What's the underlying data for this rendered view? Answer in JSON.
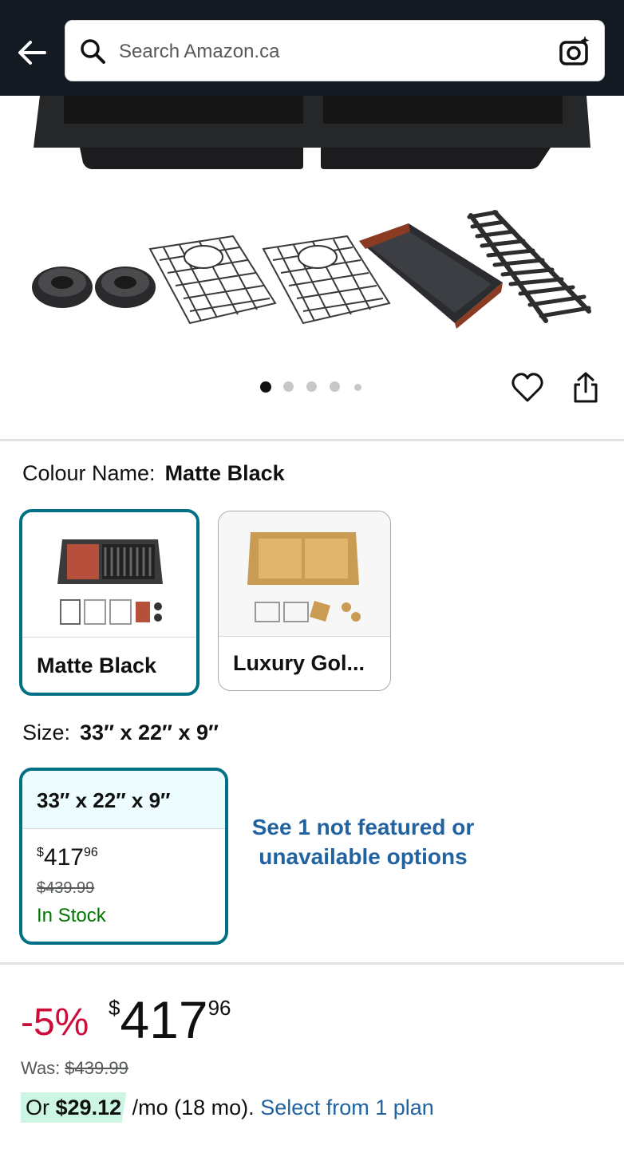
{
  "header": {
    "search_placeholder": "Search Amazon.ca",
    "icons": [
      "back-arrow-icon",
      "search-icon",
      "camera-search-icon"
    ]
  },
  "gallery": {
    "image_count": 5,
    "active_index": 0,
    "icons": [
      "heart-icon",
      "share-icon"
    ]
  },
  "colour": {
    "label": "Colour Name:",
    "selected": "Matte Black",
    "options": [
      {
        "name": "Matte Black",
        "selected": true
      },
      {
        "name": "Luxury Gol...",
        "selected": false
      }
    ]
  },
  "size": {
    "label": "Size:",
    "selected": "33″ x 22″ x 9″",
    "option": {
      "name": "33″ x 22″ x 9″",
      "currency": "$",
      "price_whole": "417",
      "price_cents": "96",
      "was": "$439.99",
      "stock": "In Stock"
    },
    "not_featured_link": "See 1 not featured or unavailable options"
  },
  "buybox": {
    "discount": "-5%",
    "currency": "$",
    "price_whole": "417",
    "price_cents": "96",
    "was_label": "Was:",
    "was_price": "$439.99",
    "plan_prefix": "Or",
    "plan_amount": "$29.12",
    "plan_suffix": "/mo (18 mo).",
    "plan_link": "Select from 1 plan"
  },
  "colors": {
    "header_bg": "#131a22",
    "selected_border": "#007185",
    "link": "#2162a1",
    "discount": "#cc0c39",
    "in_stock": "#007600"
  }
}
